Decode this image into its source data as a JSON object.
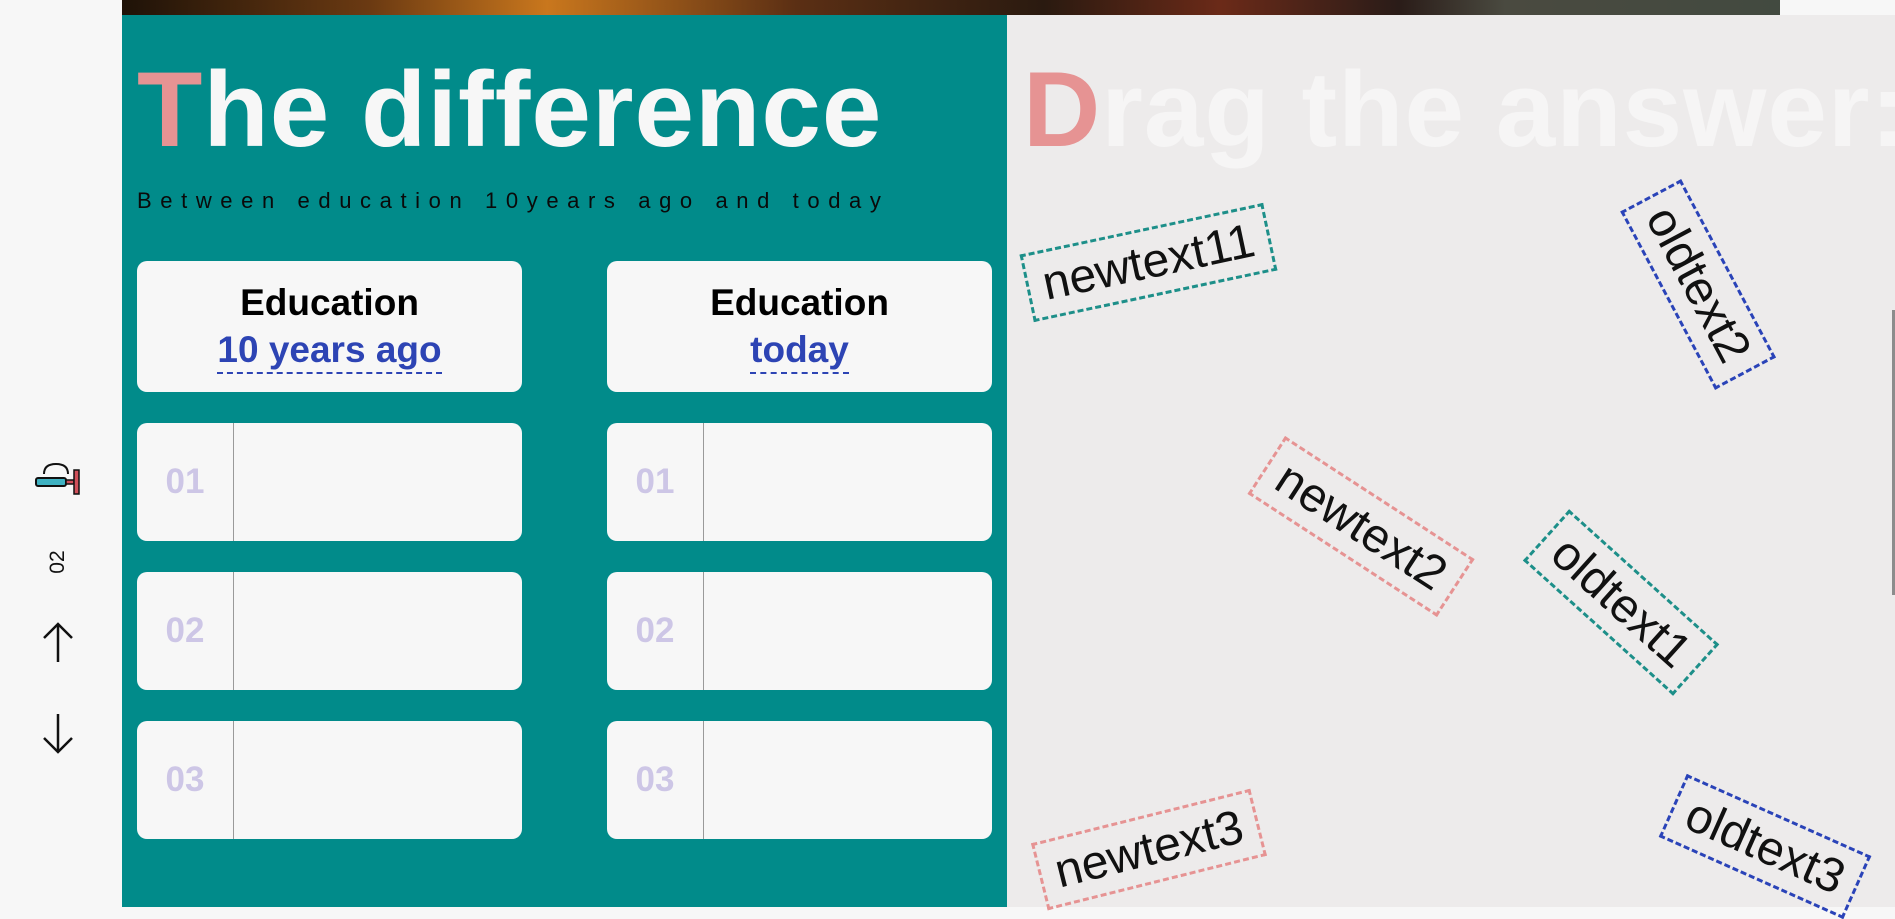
{
  "sidebar": {
    "icon": "paint-tool-icon",
    "page_number": "02",
    "up_icon": "arrow-up-icon",
    "down_icon": "arrow-down-icon"
  },
  "left": {
    "title_cap": "T",
    "title_rest": "he difference",
    "subtitle": "Between education 10years ago and today",
    "columns": [
      {
        "label": "Education",
        "sublabel": "10 years ago",
        "slots": [
          "01",
          "02",
          "03"
        ]
      },
      {
        "label": "Education",
        "sublabel": "today",
        "slots": [
          "01",
          "02",
          "03"
        ]
      }
    ]
  },
  "right": {
    "title_cap": "D",
    "title_rest": "rag the answer:",
    "chips": [
      {
        "text": "newtext11",
        "color": "teal"
      },
      {
        "text": "oldtext2",
        "color": "blue"
      },
      {
        "text": "newtext2",
        "color": "pink"
      },
      {
        "text": "oldtext1",
        "color": "teal"
      },
      {
        "text": "newtext3",
        "color": "pink"
      },
      {
        "text": "oldtext3",
        "color": "blue"
      }
    ]
  },
  "colors": {
    "teal": "#018b8a",
    "pink": "#e69393",
    "blue": "#2d44b4",
    "panel_light": "#edebeb"
  }
}
